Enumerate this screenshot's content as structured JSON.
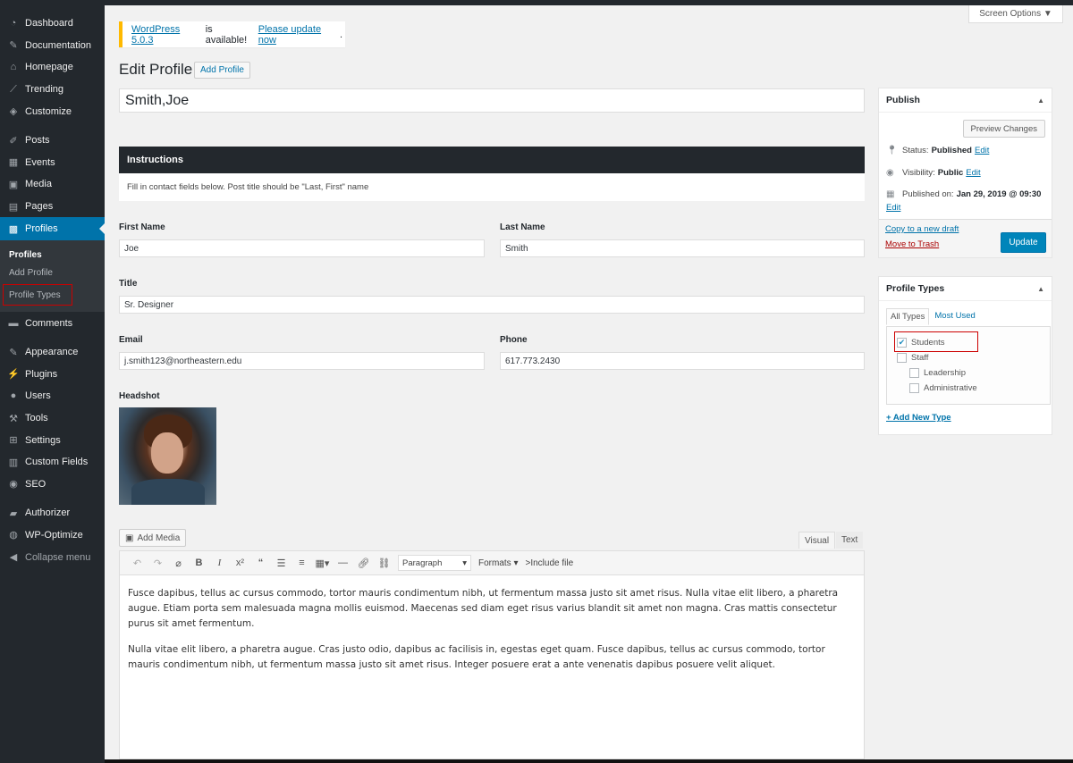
{
  "sidebar": {
    "items": [
      {
        "label": "Dashboard",
        "icon": "dashboard-icon"
      },
      {
        "label": "Documentation",
        "icon": "pen-icon"
      },
      {
        "label": "Homepage",
        "icon": "home-icon"
      },
      {
        "label": "Trending",
        "icon": "chart-icon"
      },
      {
        "label": "Customize",
        "icon": "paintbrush-icon"
      },
      {
        "label": "Posts",
        "icon": "pin-icon"
      },
      {
        "label": "Events",
        "icon": "calendar-icon"
      },
      {
        "label": "Media",
        "icon": "media-icon"
      },
      {
        "label": "Pages",
        "icon": "page-icon"
      },
      {
        "label": "Profiles",
        "icon": "profile-icon"
      },
      {
        "label": "Comments",
        "icon": "comment-icon"
      },
      {
        "label": "Appearance",
        "icon": "appearance-icon"
      },
      {
        "label": "Plugins",
        "icon": "plugin-icon"
      },
      {
        "label": "Users",
        "icon": "users-icon"
      },
      {
        "label": "Tools",
        "icon": "wrench-icon"
      },
      {
        "label": "Settings",
        "icon": "settings-icon"
      },
      {
        "label": "Custom Fields",
        "icon": "fields-icon"
      },
      {
        "label": "SEO",
        "icon": "seo-icon"
      },
      {
        "label": "Authorizer",
        "icon": "authorizer-icon"
      },
      {
        "label": "WP-Optimize",
        "icon": "optimize-icon"
      },
      {
        "label": "Collapse menu",
        "icon": "collapse-icon"
      }
    ],
    "submenu": {
      "head": "Profiles",
      "items": [
        "Add Profile",
        "Profile Types"
      ]
    }
  },
  "screen_options": "Screen Options",
  "notice": {
    "link1": "WordPress 5.0.3",
    "text": "is available!",
    "link2": "Please update now",
    "dot": "."
  },
  "page": {
    "title": "Edit Profile",
    "add_button": "Add Profile",
    "post_title": "Smith,Joe"
  },
  "instructions": {
    "heading": "Instructions",
    "body": "Fill in contact fields below. Post title should be \"Last, First\" name"
  },
  "fields": {
    "first_name": {
      "label": "First Name",
      "value": "Joe"
    },
    "last_name": {
      "label": "Last Name",
      "value": "Smith"
    },
    "title": {
      "label": "Title",
      "value": "Sr. Designer"
    },
    "email": {
      "label": "Email",
      "value": "j.smith123@northeastern.edu"
    },
    "phone": {
      "label": "Phone",
      "value": "617.773.2430"
    },
    "headshot": {
      "label": "Headshot"
    }
  },
  "editor": {
    "add_media": "Add Media",
    "tab_visual": "Visual",
    "tab_text": "Text",
    "format_select": "Paragraph",
    "formats": "Formats",
    "include_file": ">Include file",
    "paragraphs": [
      "Fusce dapibus, tellus ac cursus commodo, tortor mauris condimentum nibh, ut fermentum massa justo sit amet risus. Nulla vitae elit libero, a pharetra augue. Etiam porta sem malesuada magna mollis euismod. Maecenas sed diam eget risus varius blandit sit amet non magna. Cras mattis consectetur purus sit amet fermentum.",
      "Nulla vitae elit libero, a pharetra augue. Cras justo odio, dapibus ac facilisis in, egestas eget quam. Fusce dapibus, tellus ac cursus commodo, tortor mauris condimentum nibh, ut fermentum massa justo sit amet risus. Integer posuere erat a ante venenatis dapibus posuere velit aliquet."
    ]
  },
  "publish": {
    "heading": "Publish",
    "preview": "Preview Changes",
    "status_label": "Status:",
    "status_value": "Published",
    "visibility_label": "Visibility:",
    "visibility_value": "Public",
    "published_label": "Published on:",
    "published_value": "Jan 29, 2019 @ 09:30",
    "edit": "Edit",
    "copy_draft": "Copy to a new draft",
    "trash": "Move to Trash",
    "update": "Update"
  },
  "profile_types": {
    "heading": "Profile Types",
    "tab_all": "All Types",
    "tab_most": "Most Used",
    "items": [
      {
        "label": "Students",
        "checked": true
      },
      {
        "label": "Staff",
        "checked": false
      },
      {
        "label": "Leadership",
        "checked": false
      },
      {
        "label": "Administrative",
        "checked": false
      }
    ],
    "add_new": "+ Add New Type"
  },
  "colors": {
    "sidebar_bg": "#23282d",
    "accent": "#0073aa",
    "highlight_border": "#cc0000"
  }
}
